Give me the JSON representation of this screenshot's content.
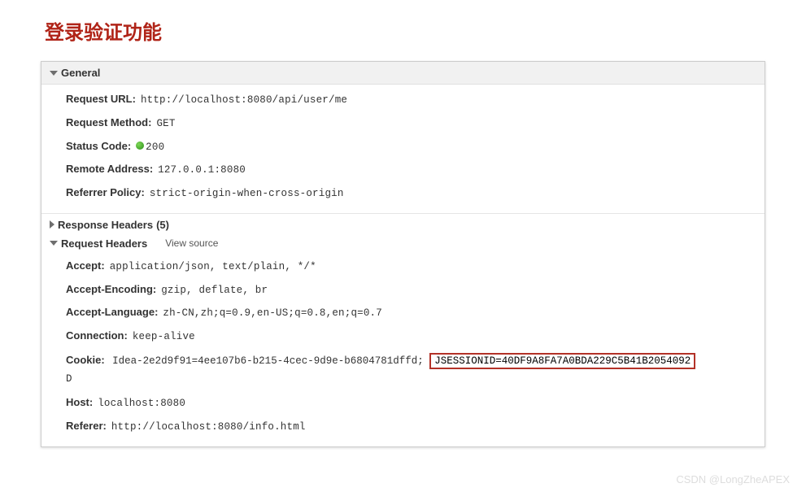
{
  "title": "登录验证功能",
  "sections": {
    "general": {
      "label": "General",
      "items": {
        "request_url": {
          "label": "Request URL:",
          "value": "http://localhost:8080/api/user/me"
        },
        "request_method": {
          "label": "Request Method:",
          "value": "GET"
        },
        "status_code": {
          "label": "Status Code:",
          "value": "200"
        },
        "remote_address": {
          "label": "Remote Address:",
          "value": "127.0.0.1:8080"
        },
        "referrer_policy": {
          "label": "Referrer Policy:",
          "value": "strict-origin-when-cross-origin"
        }
      }
    },
    "response_headers": {
      "label": "Response Headers",
      "count": "(5)"
    },
    "request_headers": {
      "label": "Request Headers",
      "view_source": "View source",
      "items": {
        "accept": {
          "label": "Accept:",
          "value": "application/json, text/plain, */*"
        },
        "accept_encoding": {
          "label": "Accept-Encoding:",
          "value": "gzip, deflate, br"
        },
        "accept_language": {
          "label": "Accept-Language:",
          "value": "zh-CN,zh;q=0.9,en-US;q=0.8,en;q=0.7"
        },
        "connection": {
          "label": "Connection:",
          "value": "keep-alive"
        },
        "cookie": {
          "label": "Cookie:",
          "prefix": "Idea-2e2d9f91=4ee107b6-b215-4cec-9d9e-b6804781dffd; ",
          "highlighted": "JSESSIONID=40DF9A8FA7A0BDA229C5B41B2054092",
          "suffix": "D"
        },
        "host": {
          "label": "Host:",
          "value": "localhost:8080"
        },
        "referer": {
          "label": "Referer:",
          "value": "http://localhost:8080/info.html"
        }
      }
    }
  },
  "watermark": "CSDN @LongZheAPEX"
}
